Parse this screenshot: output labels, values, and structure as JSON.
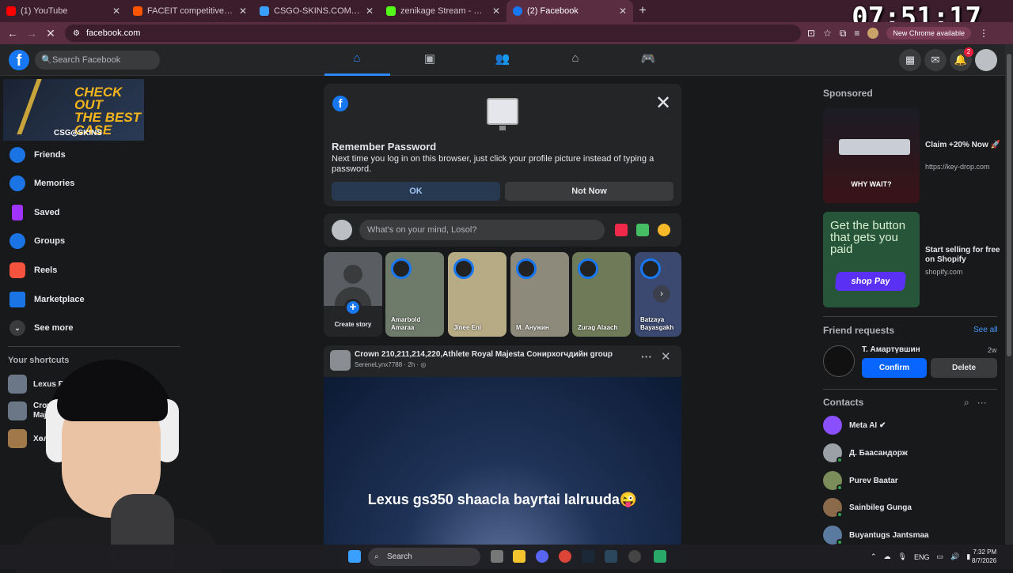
{
  "browser": {
    "tabs": [
      {
        "title": "(1) YouTube",
        "color": "#ff0000"
      },
      {
        "title": "FACEIT competitive match - FAC",
        "color": "#ff5500"
      },
      {
        "title": "CSGO-SKINS.COM - The best C",
        "color": "#3aa0ff"
      },
      {
        "title": "zenikage Stream - Watch Live o",
        "color": "#53fc18"
      },
      {
        "title": "(2) Facebook",
        "color": "#1877f2"
      }
    ],
    "url": "facebook.com",
    "new_chrome": "New Chrome available",
    "overlay_clock": "07:51:17"
  },
  "fb": {
    "search_placeholder": "Search Facebook",
    "notif_count": "2",
    "ad_banner": {
      "line1": "CHECK OUT",
      "line2": "THE BEST",
      "line3": "CASE",
      "brand": "CSG◎SKINS"
    },
    "nav": [
      {
        "label": "Friends",
        "color": "#1b74e4"
      },
      {
        "label": "Memories",
        "color": "#1b74e4"
      },
      {
        "label": "Saved",
        "color": "#a033ff"
      },
      {
        "label": "Groups",
        "color": "#1b74e4"
      },
      {
        "label": "Reels",
        "color": "#f5533d"
      },
      {
        "label": "Marketplace",
        "color": "#1b74e4"
      },
      {
        "label": "See more",
        "color": "#3a3b3c"
      }
    ],
    "shortcuts_header": "Your shortcuts",
    "shortcuts": [
      "Lexus RX45",
      "Crown 21",
      "Majesta",
      "Хөл"
    ],
    "remember_password": {
      "title": "Remember Password",
      "desc": "Next time you log in on this browser, just click your profile picture instead of typing a password.",
      "ok": "OK",
      "not_now": "Not Now"
    },
    "composer_placeholder": "What's on your mind, Losol?",
    "stories": {
      "create_label": "Create story",
      "items": [
        {
          "name": "Amarbold Amaraa",
          "bg": "#6e7a6a"
        },
        {
          "name": "Jinee Eni",
          "bg": "#b7ab86"
        },
        {
          "name": "M. Анужин",
          "bg": "#8d8a7b"
        },
        {
          "name": "Zurag Alaach",
          "bg": "#6f7b58"
        },
        {
          "name": "Batzaya Bayasgakh",
          "bg": "#3b4870"
        }
      ]
    },
    "post": {
      "title": "Crown 210,211,214,220,Athlete Royal Majesta Сонирхогчдийн group",
      "sub": "SereneLynx7788 · 2h · ◎",
      "caption": "Lexus gs350 shaacla bayrtai lalruuda😜"
    },
    "sponsored_header": "Sponsored",
    "ads": [
      {
        "text": "Claim +20% Now 🚀",
        "url": "https://key-drop.com",
        "img_text": "WHY WAIT?"
      },
      {
        "text": "Start selling for free on Shopify",
        "url": "shopify.com",
        "img_text": "Get the button that gets you paid",
        "btn": "shop Pay"
      }
    ],
    "friend_requests": {
      "header": "Friend requests",
      "see_all": "See all",
      "name": "Т. Амартүвшин",
      "time": "2w",
      "confirm": "Confirm",
      "delete": "Delete"
    },
    "contacts_header": "Contacts",
    "contacts": [
      {
        "name": "Meta AI ✔",
        "color": "#8a4fff",
        "online": false
      },
      {
        "name": "Д. Баасандорж",
        "color": "#9aa0a6",
        "online": true
      },
      {
        "name": "Purev Baatar",
        "color": "#7a8d5a",
        "online": true
      },
      {
        "name": "Sainbileg Gunga",
        "color": "#8a6a4a",
        "online": true
      },
      {
        "name": "Buyantugs Jantsmaa",
        "color": "#5a7aa0",
        "online": true
      }
    ]
  },
  "taskbar": {
    "search": "Search",
    "lang": "ENG",
    "time": "7:32 PM",
    "date": "8/7/2026"
  }
}
